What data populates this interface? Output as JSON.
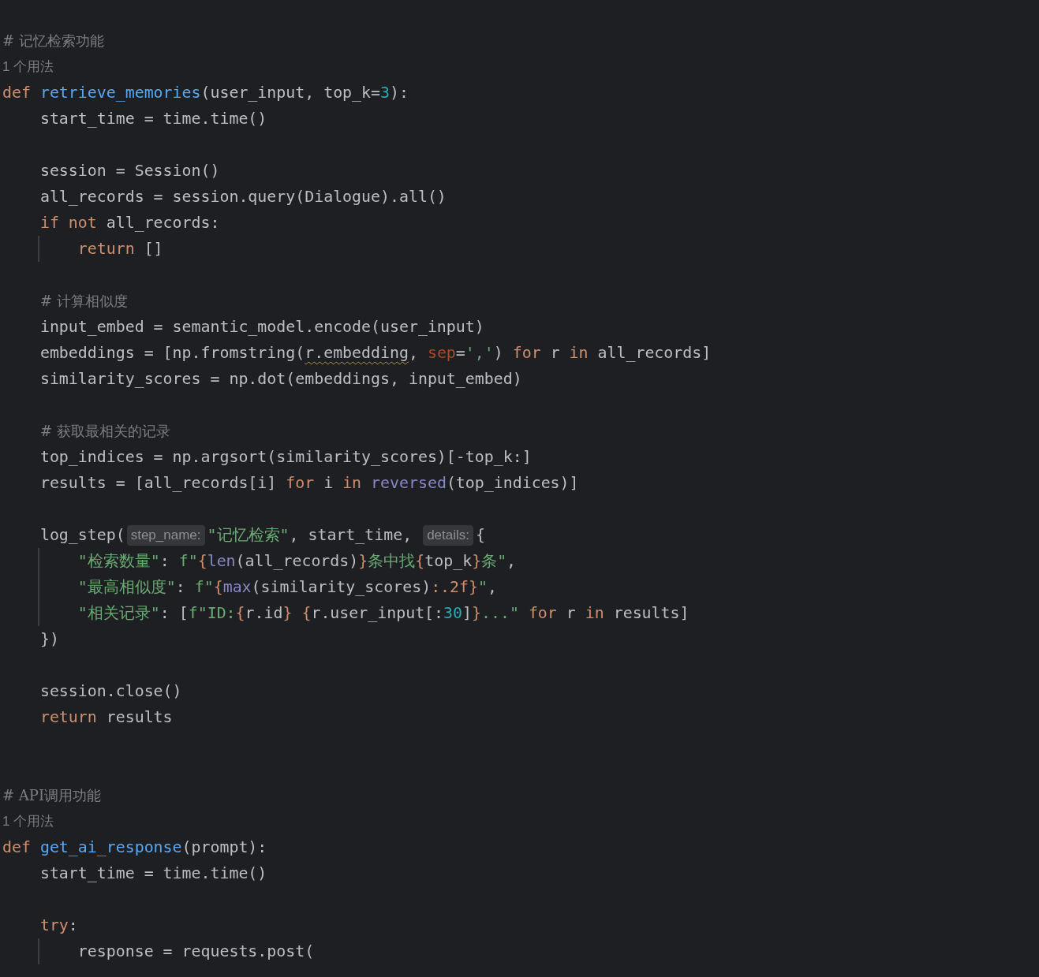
{
  "editor": {
    "lines": [
      {
        "kind": "comment",
        "tokens": [
          {
            "kind": "comment",
            "text": "# 记忆检索功能"
          }
        ]
      },
      {
        "kind": "usage",
        "tokens": [
          {
            "kind": "usage",
            "text": "1 个用法"
          }
        ]
      },
      {
        "kind": "code",
        "tokens": [
          {
            "kind": "keyword",
            "text": "def "
          },
          {
            "kind": "function",
            "text": "retrieve_memories"
          },
          {
            "kind": "plain",
            "text": "(user_input, top_k="
          },
          {
            "kind": "number",
            "text": "3"
          },
          {
            "kind": "plain",
            "text": "):"
          }
        ]
      },
      {
        "kind": "code",
        "tokens": [
          {
            "kind": "plain",
            "text": "    start_time = time.time()"
          }
        ]
      },
      {
        "kind": "blank"
      },
      {
        "kind": "code",
        "tokens": [
          {
            "kind": "plain",
            "text": "    session = Session()"
          }
        ]
      },
      {
        "kind": "code",
        "tokens": [
          {
            "kind": "plain",
            "text": "    all_records = session.query(Dialogue).all()"
          }
        ]
      },
      {
        "kind": "code",
        "tokens": [
          {
            "kind": "keyword",
            "text": "    if not "
          },
          {
            "kind": "plain",
            "text": "all_records:"
          }
        ]
      },
      {
        "kind": "code",
        "guide": true,
        "tokens": [
          {
            "kind": "keyword",
            "text": "        return "
          },
          {
            "kind": "plain",
            "text": "[]"
          }
        ]
      },
      {
        "kind": "blank"
      },
      {
        "kind": "comment",
        "tokens": [
          {
            "kind": "comment",
            "text": "    # 计算相似度"
          }
        ]
      },
      {
        "kind": "code",
        "tokens": [
          {
            "kind": "plain",
            "text": "    input_embed = semantic_model.encode(user_input)"
          }
        ]
      },
      {
        "kind": "code",
        "tokens": [
          {
            "kind": "plain",
            "text": "    embeddings = [np.fromstring("
          },
          {
            "kind": "warned",
            "text": "r.embedding"
          },
          {
            "kind": "plain",
            "text": ", "
          },
          {
            "kind": "param",
            "text": "sep"
          },
          {
            "kind": "plain",
            "text": "="
          },
          {
            "kind": "string",
            "text": "','"
          },
          {
            "kind": "plain",
            "text": ") "
          },
          {
            "kind": "keyword",
            "text": "for "
          },
          {
            "kind": "plain",
            "text": "r "
          },
          {
            "kind": "keyword",
            "text": "in "
          },
          {
            "kind": "plain",
            "text": "all_records]"
          }
        ]
      },
      {
        "kind": "code",
        "tokens": [
          {
            "kind": "plain",
            "text": "    similarity_scores = np.dot(embeddings, input_embed)"
          }
        ]
      },
      {
        "kind": "blank"
      },
      {
        "kind": "comment",
        "tokens": [
          {
            "kind": "comment",
            "text": "    # 获取最相关的记录"
          }
        ]
      },
      {
        "kind": "code",
        "tokens": [
          {
            "kind": "plain",
            "text": "    top_indices = np.argsort(similarity_scores)[-top_k:]"
          }
        ]
      },
      {
        "kind": "code",
        "tokens": [
          {
            "kind": "plain",
            "text": "    results = [all_records[i] "
          },
          {
            "kind": "keyword",
            "text": "for "
          },
          {
            "kind": "plain",
            "text": "i "
          },
          {
            "kind": "keyword",
            "text": "in "
          },
          {
            "kind": "builtin",
            "text": "reversed"
          },
          {
            "kind": "plain",
            "text": "(top_indices)]"
          }
        ]
      },
      {
        "kind": "blank"
      },
      {
        "kind": "code",
        "tokens": [
          {
            "kind": "plain",
            "text": "    log_step("
          },
          {
            "kind": "hint",
            "text": "step_name:"
          },
          {
            "kind": "string",
            "text": "\"记忆检索\""
          },
          {
            "kind": "plain",
            "text": ", start_time, "
          },
          {
            "kind": "hint",
            "text": "details:"
          },
          {
            "kind": "plain",
            "text": "{"
          }
        ]
      },
      {
        "kind": "code",
        "guide": true,
        "tokens": [
          {
            "kind": "string",
            "text": "        \"检索数量\""
          },
          {
            "kind": "plain",
            "text": ": "
          },
          {
            "kind": "string",
            "text": "f\""
          },
          {
            "kind": "brace",
            "text": "{"
          },
          {
            "kind": "builtin",
            "text": "len"
          },
          {
            "kind": "plain",
            "text": "(all_records)"
          },
          {
            "kind": "brace",
            "text": "}"
          },
          {
            "kind": "string",
            "text": "条中找"
          },
          {
            "kind": "brace",
            "text": "{"
          },
          {
            "kind": "plain",
            "text": "top_k"
          },
          {
            "kind": "brace",
            "text": "}"
          },
          {
            "kind": "string",
            "text": "条\""
          },
          {
            "kind": "plain",
            "text": ","
          }
        ]
      },
      {
        "kind": "code",
        "guide": true,
        "tokens": [
          {
            "kind": "string",
            "text": "        \"最高相似度\""
          },
          {
            "kind": "plain",
            "text": ": "
          },
          {
            "kind": "string",
            "text": "f\""
          },
          {
            "kind": "brace",
            "text": "{"
          },
          {
            "kind": "builtin",
            "text": "max"
          },
          {
            "kind": "plain",
            "text": "(similarity_scores)"
          },
          {
            "kind": "brace",
            "text": ":.2f}"
          },
          {
            "kind": "string",
            "text": "\""
          },
          {
            "kind": "plain",
            "text": ","
          }
        ]
      },
      {
        "kind": "code",
        "guide": true,
        "tokens": [
          {
            "kind": "string",
            "text": "        \"相关记录\""
          },
          {
            "kind": "plain",
            "text": ": ["
          },
          {
            "kind": "string",
            "text": "f\"ID:"
          },
          {
            "kind": "brace",
            "text": "{"
          },
          {
            "kind": "plain",
            "text": "r.id"
          },
          {
            "kind": "brace",
            "text": "} {"
          },
          {
            "kind": "plain",
            "text": "r.user_input[:"
          },
          {
            "kind": "number",
            "text": "30"
          },
          {
            "kind": "plain",
            "text": "]"
          },
          {
            "kind": "brace",
            "text": "}"
          },
          {
            "kind": "string",
            "text": "...\" "
          },
          {
            "kind": "keyword",
            "text": "for "
          },
          {
            "kind": "plain",
            "text": "r "
          },
          {
            "kind": "keyword",
            "text": "in "
          },
          {
            "kind": "plain",
            "text": "results]"
          }
        ]
      },
      {
        "kind": "code",
        "tokens": [
          {
            "kind": "plain",
            "text": "    })"
          }
        ]
      },
      {
        "kind": "blank"
      },
      {
        "kind": "code",
        "tokens": [
          {
            "kind": "plain",
            "text": "    session.close()"
          }
        ]
      },
      {
        "kind": "code",
        "tokens": [
          {
            "kind": "keyword",
            "text": "    return "
          },
          {
            "kind": "plain",
            "text": "results"
          }
        ]
      },
      {
        "kind": "blank"
      },
      {
        "kind": "blank"
      },
      {
        "kind": "comment",
        "tokens": [
          {
            "kind": "comment",
            "text": "# API调用功能"
          }
        ]
      },
      {
        "kind": "usage",
        "tokens": [
          {
            "kind": "usage",
            "text": "1 个用法"
          }
        ]
      },
      {
        "kind": "code",
        "tokens": [
          {
            "kind": "keyword",
            "text": "def "
          },
          {
            "kind": "function",
            "text": "get_ai_response"
          },
          {
            "kind": "plain",
            "text": "(prompt):"
          }
        ]
      },
      {
        "kind": "code",
        "tokens": [
          {
            "kind": "plain",
            "text": "    start_time = time.time()"
          }
        ]
      },
      {
        "kind": "blank"
      },
      {
        "kind": "code",
        "tokens": [
          {
            "kind": "keyword",
            "text": "    try"
          },
          {
            "kind": "plain",
            "text": ":"
          }
        ]
      },
      {
        "kind": "code",
        "guide": true,
        "tokens": [
          {
            "kind": "plain",
            "text": "        response = requests.post("
          }
        ]
      }
    ]
  }
}
